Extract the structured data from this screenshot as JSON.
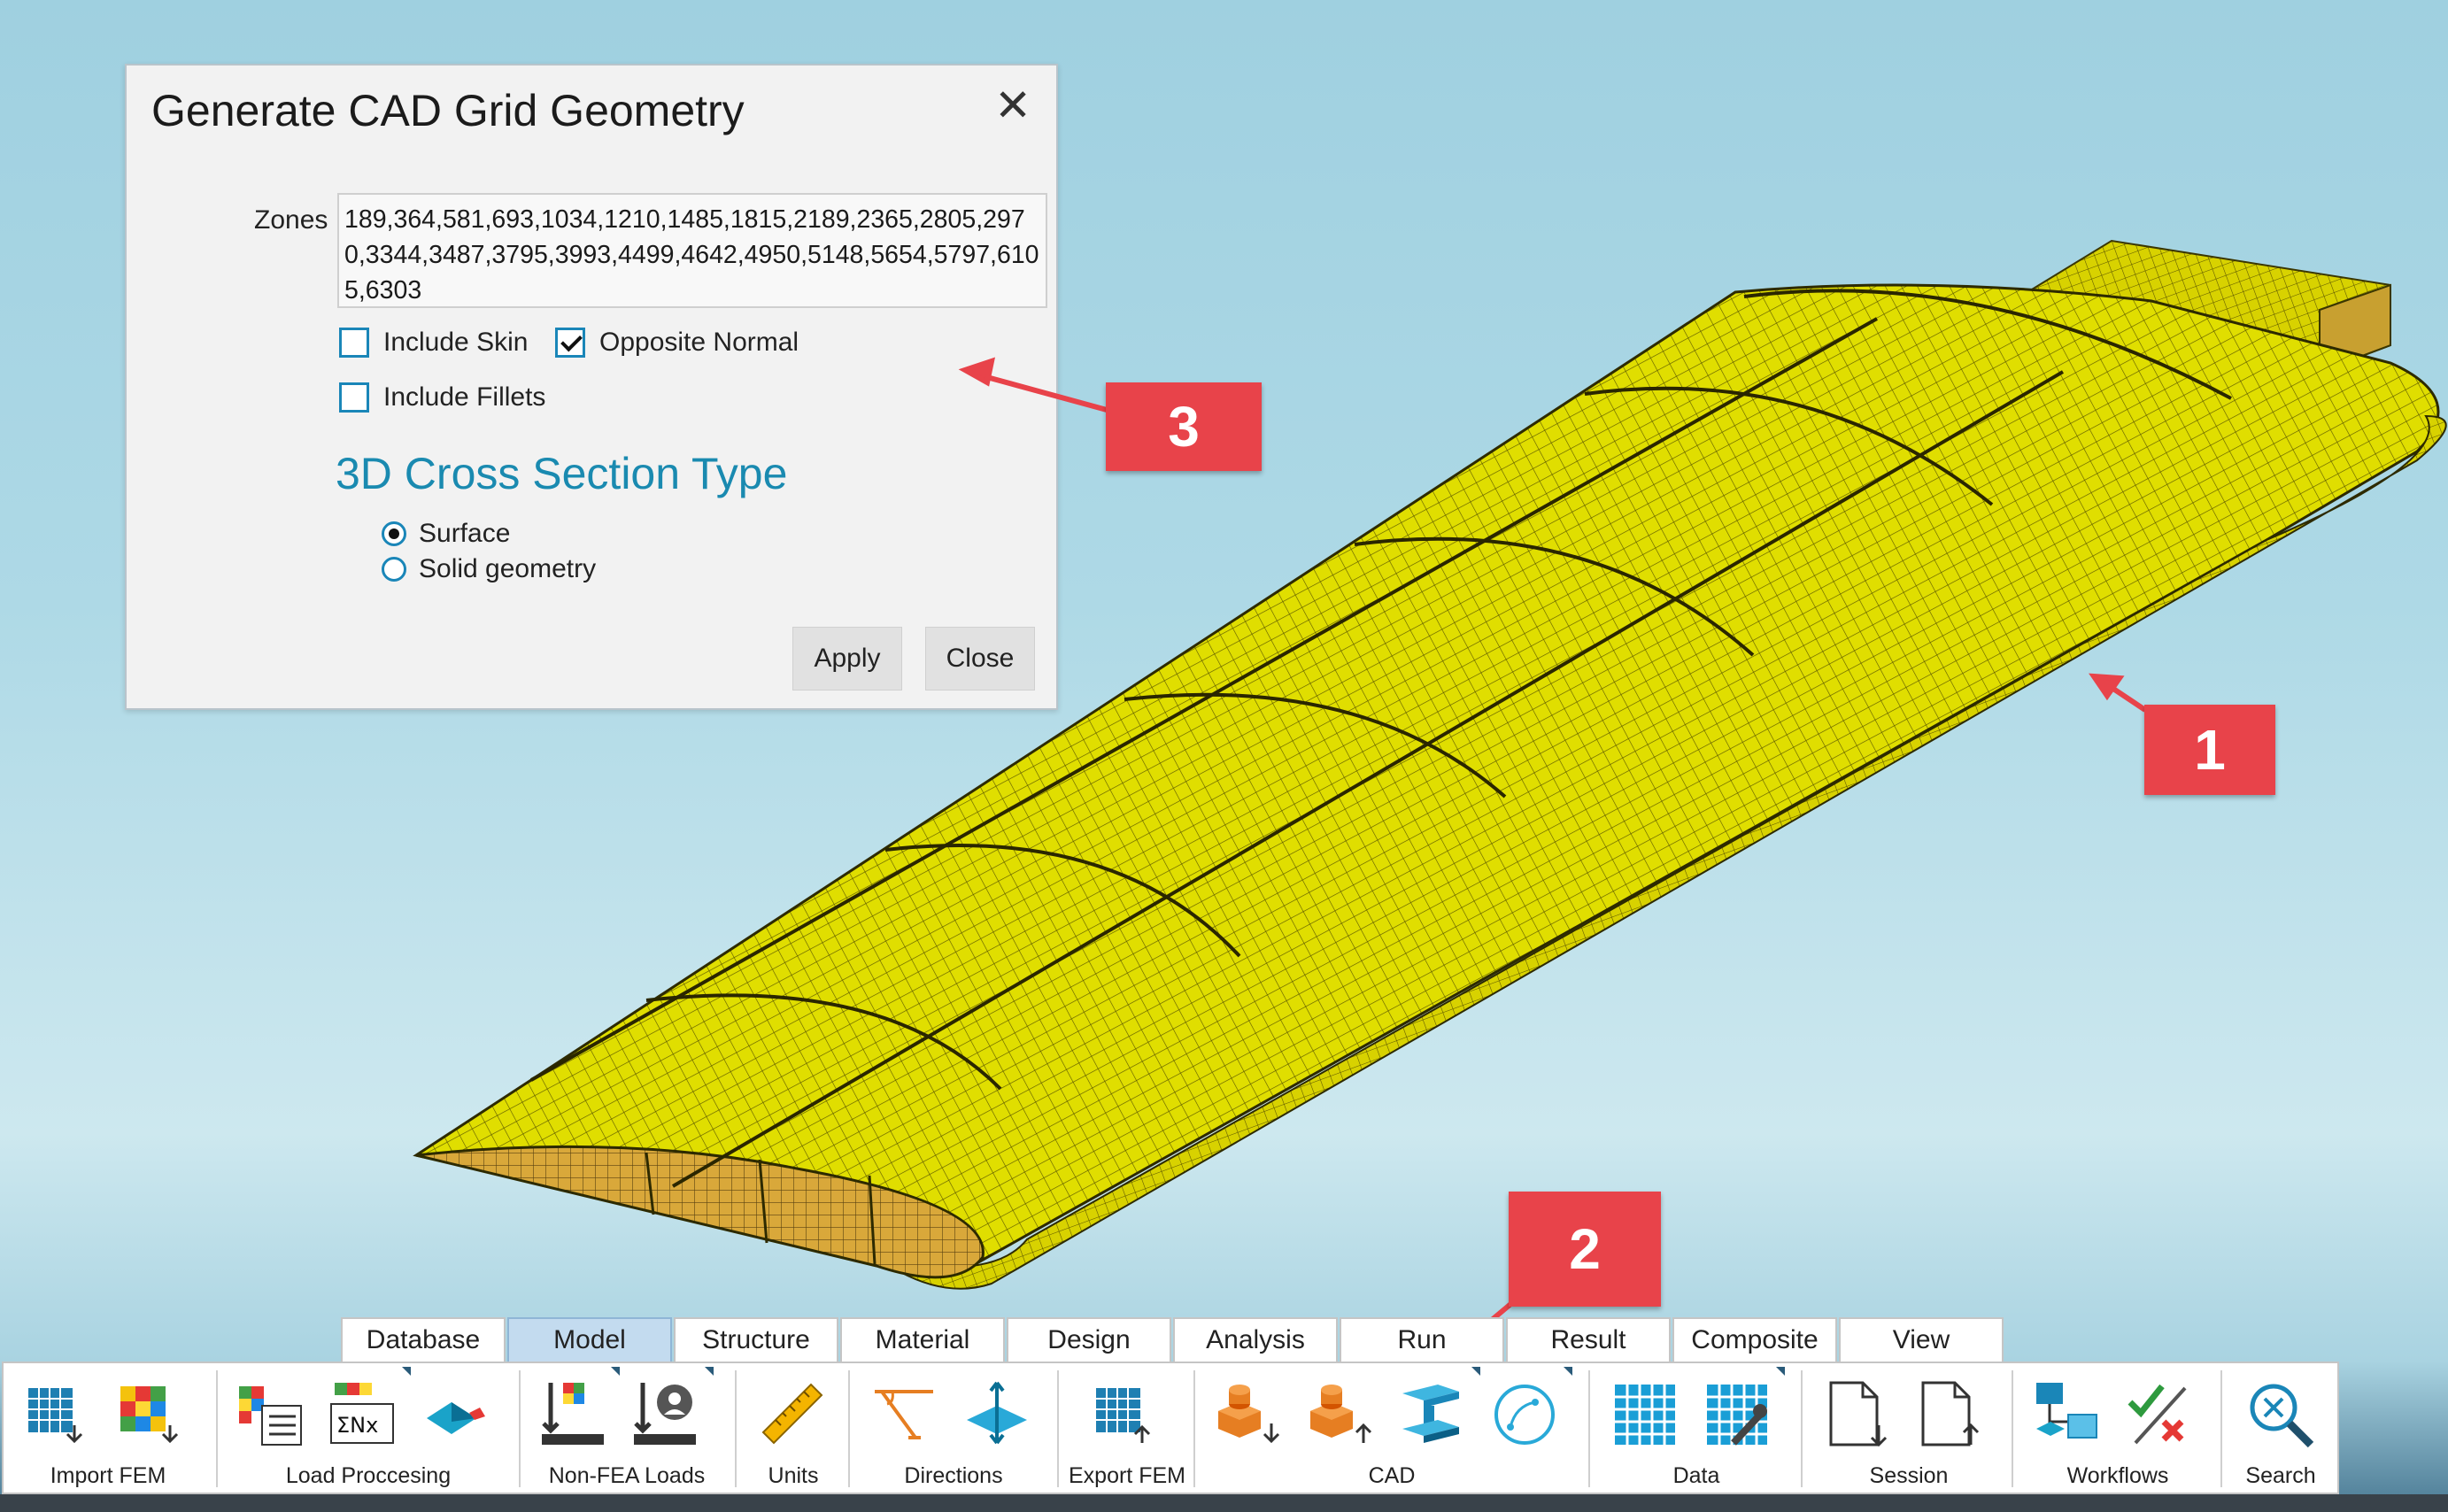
{
  "dialog": {
    "title": "Generate CAD Grid Geometry",
    "close_icon": "close-icon",
    "zones_label": "Zones",
    "zones_value": "189,364,581,693,1034,1210,1485,1815,2189,2365,2805,2970,3344,3487,3795,3993,4499,4642,4950,5148,5654,5797,6105,6303",
    "include_skin": {
      "label": "Include Skin",
      "checked": false
    },
    "opposite_normal": {
      "label": "Opposite Normal",
      "checked": true
    },
    "include_fillets": {
      "label": "Include Fillets",
      "checked": false
    },
    "section_title": "3D Cross Section Type",
    "radio_surface": {
      "label": "Surface",
      "selected": true
    },
    "radio_solid": {
      "label": "Solid geometry",
      "selected": false
    },
    "apply_label": "Apply",
    "close_label": "Close"
  },
  "callouts": [
    "3",
    "1",
    "2"
  ],
  "tabs": [
    "Database",
    "Model",
    "Structure",
    "Material",
    "Design",
    "Analysis",
    "Run",
    "Result",
    "Composite",
    "View"
  ],
  "active_tab": "Model",
  "ribbon": {
    "groups": [
      {
        "label": "Import FEM",
        "icons": [
          "import-mesh-icon",
          "import-contour-icon"
        ]
      },
      {
        "label": "Load Proccesing",
        "icons": [
          "load-table-icon",
          "sum-nx-icon",
          "load-diamond-icon"
        ]
      },
      {
        "label": "Non-FEA Loads",
        "icons": [
          "non-fea-loads-icon",
          "user-load-icon"
        ]
      },
      {
        "label": "Units",
        "icons": [
          "ruler-icon"
        ]
      },
      {
        "label": "Directions",
        "icons": [
          "direction-angle-icon",
          "axes-icon"
        ]
      },
      {
        "label": "Export FEM",
        "icons": [
          "export-mesh-icon"
        ]
      },
      {
        "label": "CAD",
        "icons": [
          "cad-import-icon",
          "cad-export-icon",
          "i-beam-icon",
          "curve-icon"
        ]
      },
      {
        "label": "Data",
        "icons": [
          "data-grid-icon",
          "data-tools-icon"
        ]
      },
      {
        "label": "Session",
        "icons": [
          "session-open-icon",
          "session-save-icon"
        ]
      },
      {
        "label": "Workflows",
        "icons": [
          "workflow-icon",
          "check-cross-icon"
        ]
      },
      {
        "label": "Search",
        "icons": [
          "search-icon"
        ]
      }
    ]
  },
  "colors": {
    "wing": "#e2e000",
    "accent": "#1a8ab0",
    "callout": "#e8434a",
    "active_tab": "#c3dbef"
  }
}
